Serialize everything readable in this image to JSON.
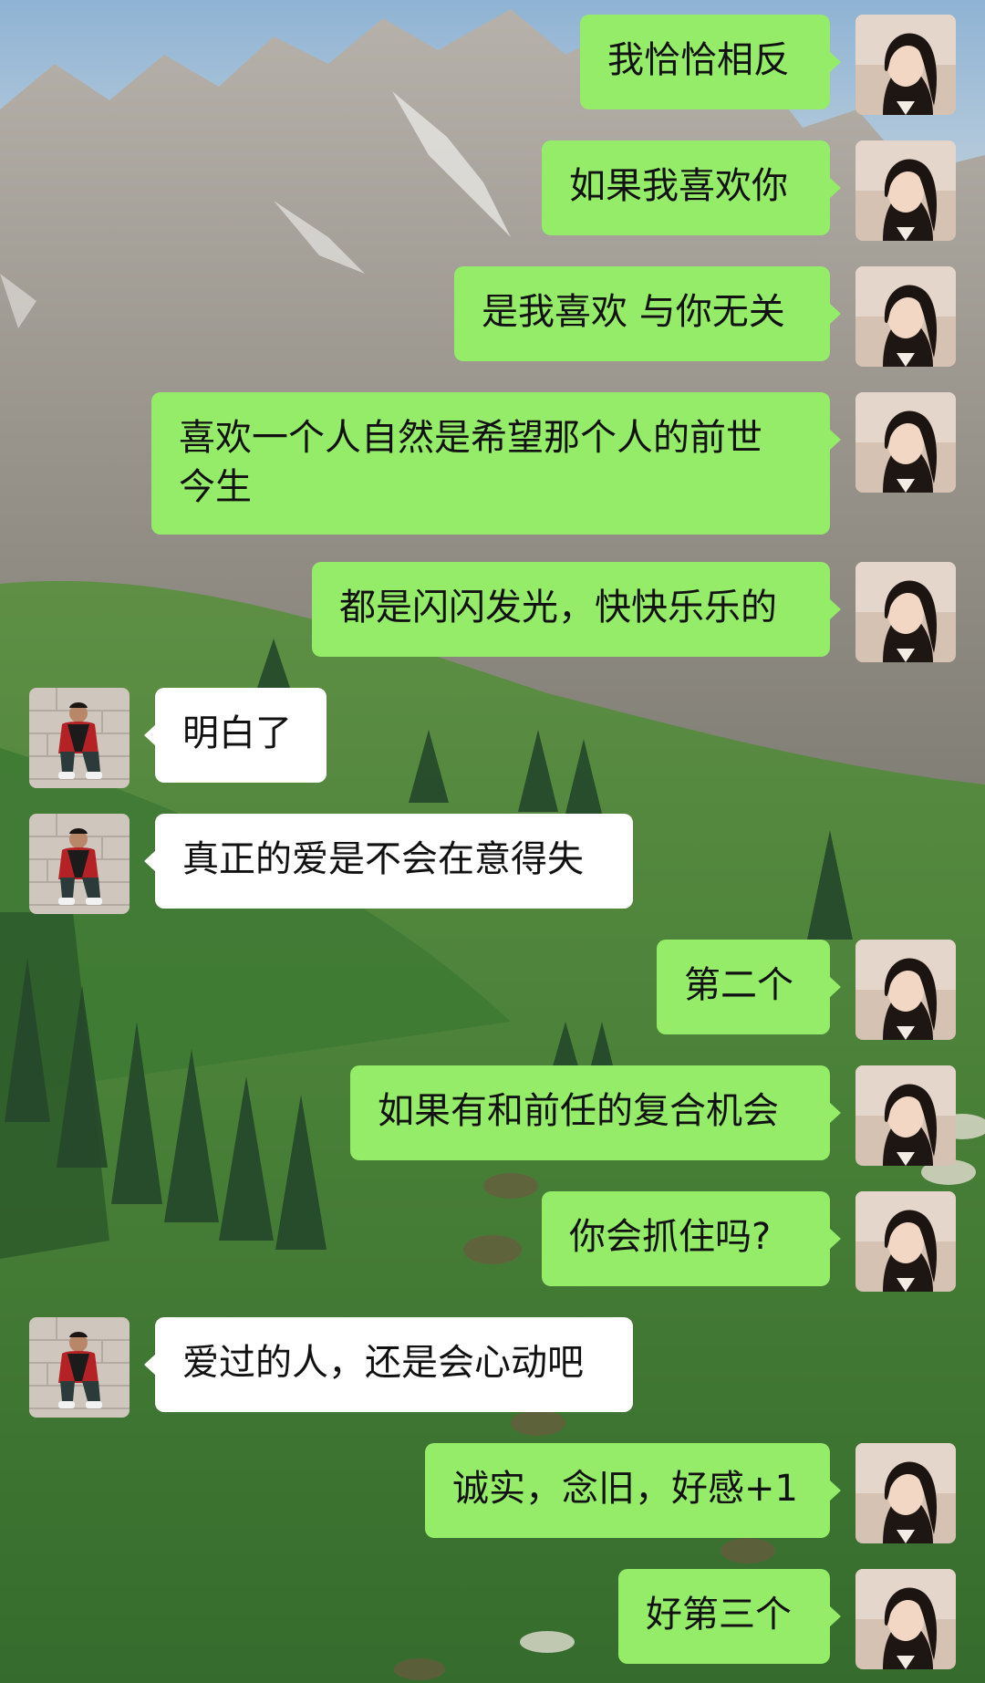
{
  "wallpaper": {
    "sky_color": "#a8c3d8",
    "mountain_color": "#a29c94",
    "grass_color": "#4a7d39",
    "tree_color": "#2a4d2a"
  },
  "colors": {
    "outgoing_bubble": "#95ec69",
    "incoming_bubble": "#ffffff"
  },
  "messages": [
    {
      "side": "right",
      "text": "我恰恰相反"
    },
    {
      "side": "right",
      "text": "如果我喜欢你"
    },
    {
      "side": "right",
      "text": "是我喜欢 与你无关"
    },
    {
      "side": "right",
      "text": "喜欢一个人自然是希望那个人的前世\n今生"
    },
    {
      "side": "right",
      "text": "都是闪闪发光，快快乐乐的"
    },
    {
      "side": "left",
      "text": "明白了"
    },
    {
      "side": "left",
      "text": "真正的爱是不会在意得失"
    },
    {
      "side": "right",
      "text": "第二个"
    },
    {
      "side": "right",
      "text": "如果有和前任的复合机会"
    },
    {
      "side": "right",
      "text": "你会抓住吗?"
    },
    {
      "side": "left",
      "text": "爱过的人，还是会心动吧"
    },
    {
      "side": "right",
      "text": "诚实，念旧，好感+1"
    },
    {
      "side": "right",
      "text": "好第三个"
    }
  ]
}
